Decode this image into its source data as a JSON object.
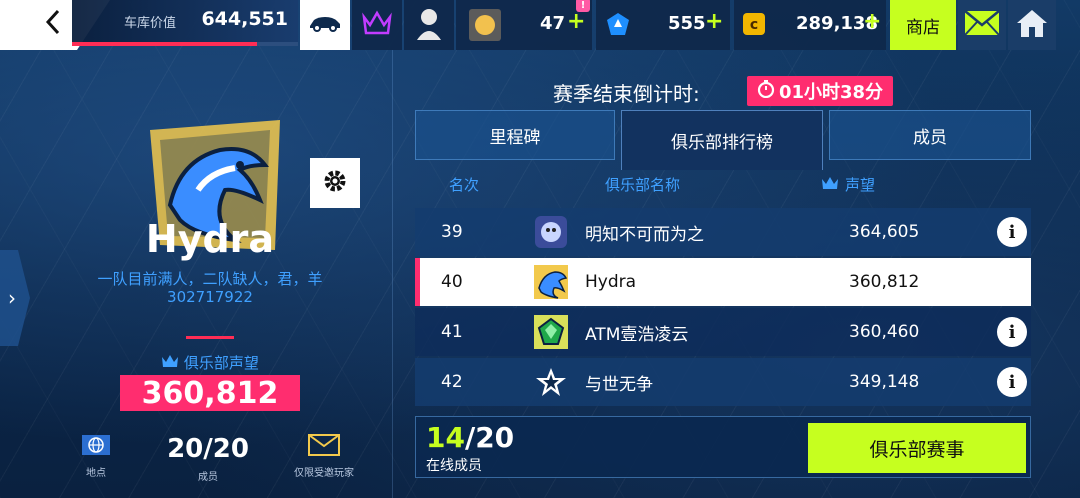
{
  "topbar": {
    "garage_label": "车库价值",
    "garage_value": "644,551",
    "garage_progress": 0.82,
    "tokens": "47",
    "notif": "!",
    "blue_currency": "555",
    "credits": "289,138",
    "plus": "+",
    "shop_label": "商店",
    "icons": [
      "back-icon",
      "car-icon",
      "crown-icon",
      "profile-icon",
      "card-pack-icon",
      "blueprint-icon",
      "credits-icon",
      "mail-icon",
      "home-icon"
    ]
  },
  "club": {
    "name": "Hydra",
    "description": "一队目前满人，二队缺人，君，羊",
    "id": "302717922",
    "reputation_label": "俱乐部声望",
    "reputation_value": "360,812",
    "location_label": "地点",
    "members_value": "20/20",
    "members_label": "成员",
    "invite_label": "仅限受邀玩家"
  },
  "season": {
    "countdown_label": "赛季结束倒计时:",
    "countdown_value": "01小时38分"
  },
  "tabs": [
    {
      "label": "里程碑",
      "active": false
    },
    {
      "label": "俱乐部排行榜",
      "active": true
    },
    {
      "label": "成员",
      "active": false
    }
  ],
  "table": {
    "headers": {
      "rank": "名次",
      "name": "俱乐部名称",
      "reputation": "声望"
    },
    "rows": [
      {
        "rank": "39",
        "name": "明知不可而为之",
        "reputation": "364,605",
        "highlight": false
      },
      {
        "rank": "40",
        "name": "Hydra",
        "reputation": "360,812",
        "highlight": true
      },
      {
        "rank": "41",
        "name": "ATM壹浩凌云",
        "reputation": "360,460",
        "highlight": false
      },
      {
        "rank": "42",
        "name": "与世无争",
        "reputation": "349,148",
        "highlight": false
      }
    ]
  },
  "online": {
    "current": "14",
    "total": "/20",
    "label": "在线成员"
  },
  "club_events_label": "俱乐部赛事",
  "colors": {
    "accent_pink": "#ff2d6f",
    "accent_lime": "#c6ff1f",
    "link_blue": "#3fa0ff"
  }
}
